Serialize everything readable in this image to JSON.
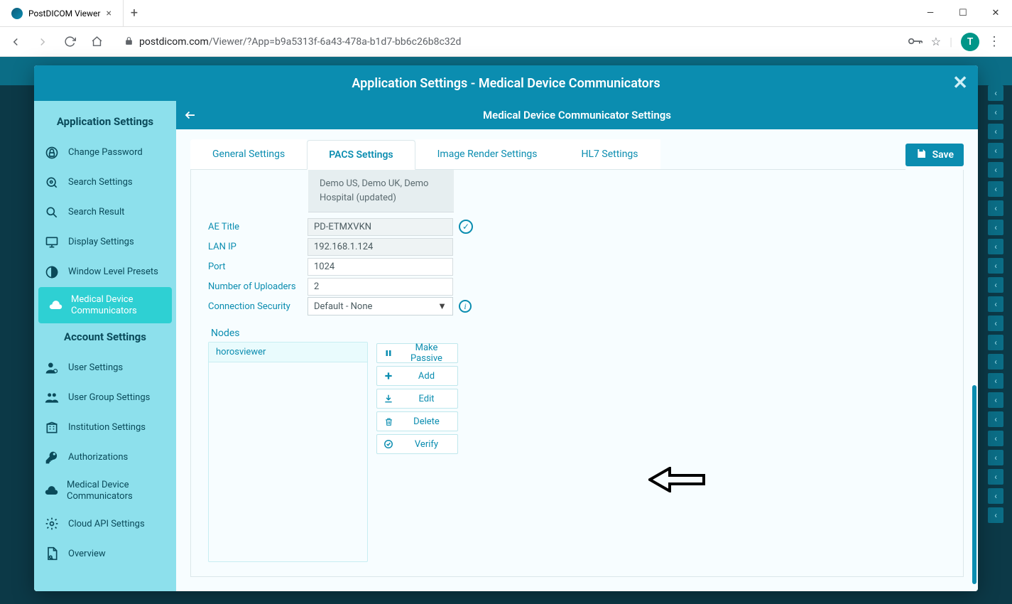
{
  "browser": {
    "tab_title": "PostDICOM Viewer",
    "url_domain": "postdicom.com",
    "url_path": "/Viewer/?App=b9a5313f-6a43-478a-b1d7-bb6c26b8c32d",
    "avatar_initial": "T"
  },
  "modal": {
    "title": "Application Settings - Medical Device Communicators"
  },
  "sidebar": {
    "section1_title": "Application Settings",
    "section2_title": "Account Settings",
    "items1": [
      {
        "label": "Change Password"
      },
      {
        "label": "Search Settings"
      },
      {
        "label": "Search Result"
      },
      {
        "label": "Display Settings"
      },
      {
        "label": "Window Level Presets"
      },
      {
        "label": "Medical Device Communicators"
      }
    ],
    "items2": [
      {
        "label": "User Settings"
      },
      {
        "label": "User Group Settings"
      },
      {
        "label": "Institution Settings"
      },
      {
        "label": "Authorizations"
      },
      {
        "label": "Medical Device Communicators"
      },
      {
        "label": "Cloud API Settings"
      },
      {
        "label": "Overview"
      }
    ]
  },
  "panel": {
    "title": "Medical Device Communicator Settings",
    "save_label": "Save",
    "tabs": [
      {
        "label": "General Settings"
      },
      {
        "label": "PACS Settings"
      },
      {
        "label": "Image Render Settings"
      },
      {
        "label": "HL7 Settings"
      }
    ],
    "banner": "Demo US, Demo UK, Demo Hospital (updated)",
    "fields": {
      "ae_title_label": "AE Title",
      "ae_title_value": "PD-ETMXVKN",
      "lan_ip_label": "LAN IP",
      "lan_ip_value": "192.168.1.124",
      "port_label": "Port",
      "port_value": "1024",
      "uploaders_label": "Number of Uploaders",
      "uploaders_value": "2",
      "connection_label": "Connection Security",
      "connection_value": "Default - None"
    },
    "nodes_title": "Nodes",
    "nodes": [
      {
        "name": "horosviewer"
      }
    ],
    "node_actions": {
      "make_passive": "Make Passive",
      "add": "Add",
      "edit": "Edit",
      "delete": "Delete",
      "verify": "Verify"
    }
  }
}
